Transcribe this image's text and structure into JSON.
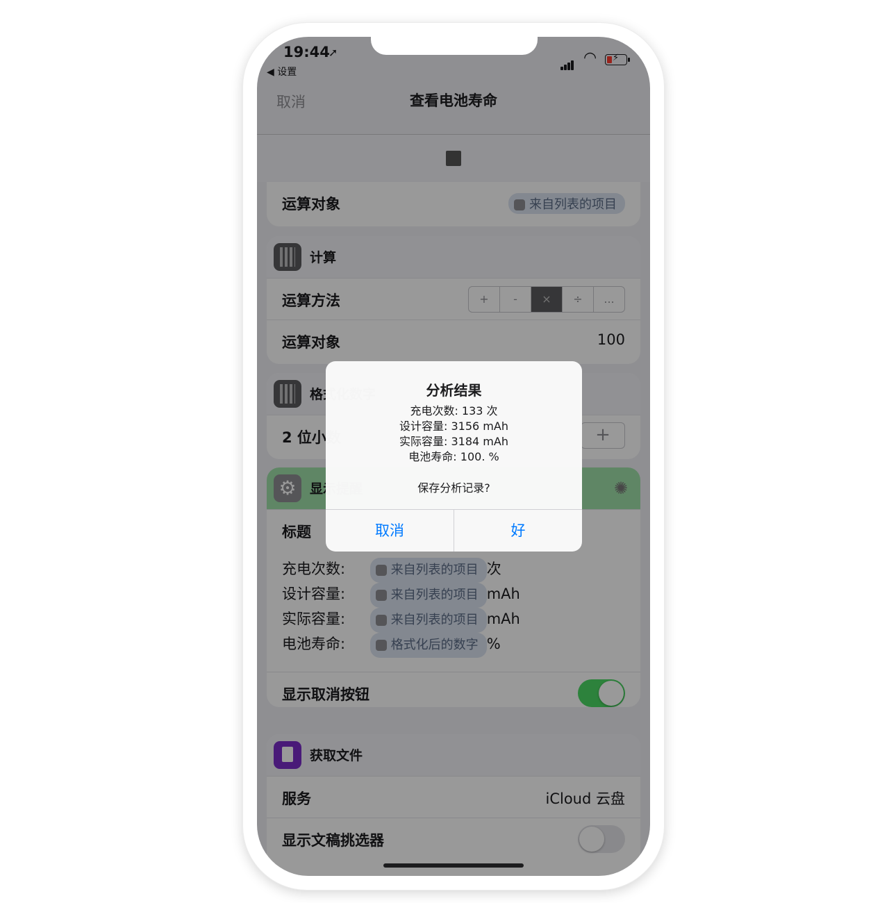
{
  "status_bar": {
    "time": "19:44",
    "back_app": "◀ 设置"
  },
  "nav": {
    "cancel": "取消",
    "title": "查看电池寿命"
  },
  "card1": {
    "row_label": "运算对象",
    "token": "来自列表的项目"
  },
  "calc": {
    "title": "计算",
    "method_label": "运算方法",
    "ops": [
      "+",
      "-",
      "×",
      "÷",
      "..."
    ],
    "operand_label": "运算对象",
    "operand_value": "100"
  },
  "format": {
    "title": "格式化数字",
    "decimals_label": "2 位小数"
  },
  "show_alert": {
    "title": "显示提醒",
    "title_label": "标题",
    "lines": [
      {
        "label": "充电次数:",
        "token": "来自列表的项目",
        "suffix": "次"
      },
      {
        "label": "设计容量:",
        "token": "来自列表的项目",
        "suffix": "mAh"
      },
      {
        "label": "实际容量:",
        "token": "来自列表的项目",
        "suffix": "mAh"
      },
      {
        "label": "电池寿命:",
        "token": "格式化后的数字",
        "suffix": "%"
      }
    ],
    "cancel_toggle_label": "显示取消按钮"
  },
  "get_file": {
    "title": "获取文件",
    "service_label": "服务",
    "service_value": "iCloud 云盘",
    "picker_label": "显示文稿挑选器"
  },
  "alert": {
    "title": "分析结果",
    "lines": [
      "充电次数: 133 次",
      "设计容量: 3156 mAh",
      "实际容量: 3184 mAh",
      "电池寿命: 100. %"
    ],
    "question": "保存分析记录?",
    "cancel": "取消",
    "ok": "好"
  },
  "colors": {
    "accent": "#007aff",
    "toggle_on": "#4cd964",
    "file_app": "#7b2cc9"
  }
}
